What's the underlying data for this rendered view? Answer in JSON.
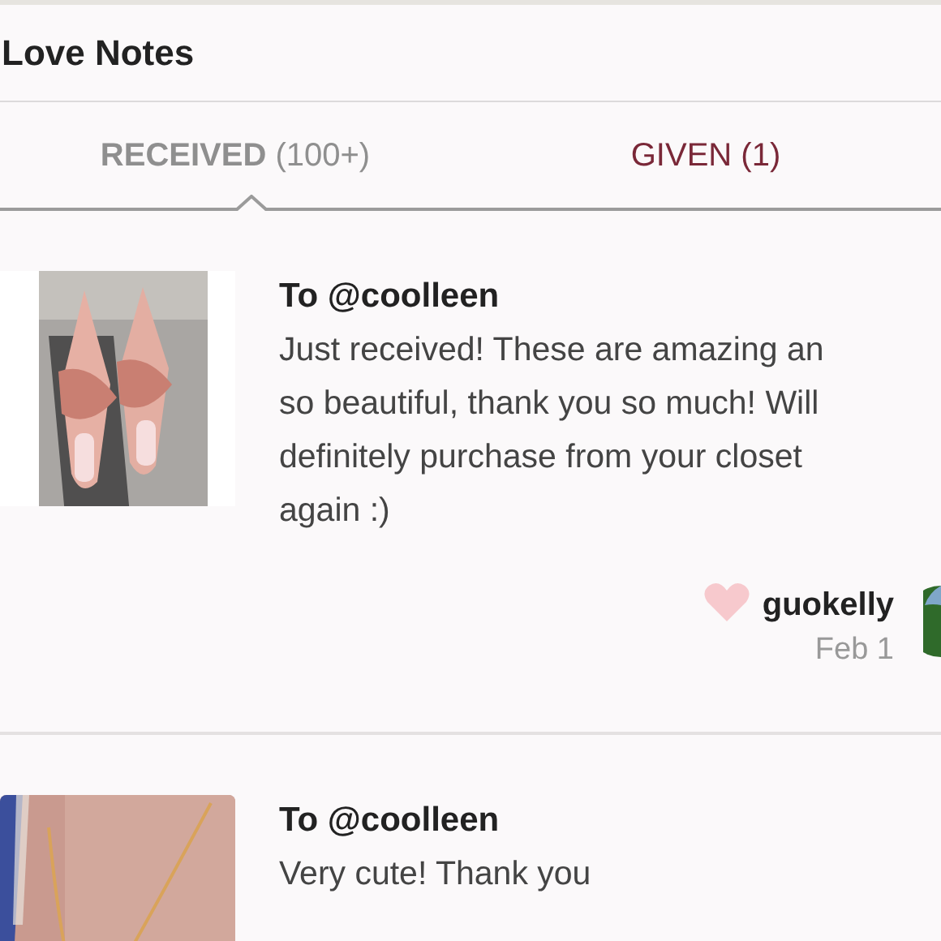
{
  "header": {
    "title": "Love Notes"
  },
  "tabs": [
    {
      "label": "RECEIVED",
      "count": "(100+)",
      "selected": true
    },
    {
      "label": "GIVEN (1)",
      "selected": false
    }
  ],
  "notes": [
    {
      "image": {
        "kind": "picture"
      },
      "to": "To @coolleen",
      "lines": [
        "Just received! These are amazing an",
        "so beautiful, thank you so much! Will",
        "definitely purchase from your closet",
        "again :)"
      ],
      "liked": true,
      "author": "guokelly",
      "date": "Feb 1"
    },
    {
      "image": {
        "kind": "picture"
      },
      "to": "To @coolleen",
      "lines": [
        "Very cute! Thank you"
      ]
    }
  ]
}
